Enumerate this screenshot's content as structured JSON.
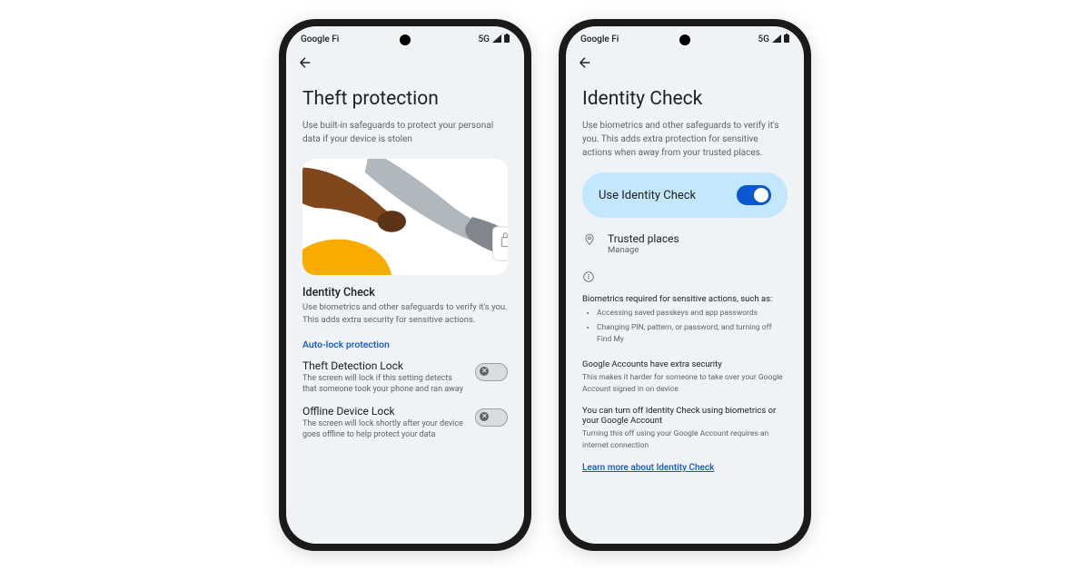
{
  "status": {
    "carrier": "Google Fi",
    "network": "5G"
  },
  "phone1": {
    "title": "Theft protection",
    "subtitle": "Use built-in safeguards to protect your personal data if your device is stolen",
    "section1": {
      "title": "Identity Check",
      "desc": "Use biometrics and other safeguards to verify it's you. This adds extra security for sensitive actions."
    },
    "linkGroup": "Auto-lock protection",
    "theft_detection": {
      "label": "Theft Detection Lock",
      "desc": "The screen will lock if this setting detects that someone took your phone and ran away"
    },
    "offline_lock": {
      "label": "Offline Device Lock",
      "desc": "The screen will lock shortly after your device goes offline to help protect your data"
    }
  },
  "phone2": {
    "title": "Identity Check",
    "subtitle": "Use biometrics and other safeguards to verify it's you. This adds extra protection for sensitive actions when away from your trusted places.",
    "toggle_label": "Use Identity Check",
    "trusted": {
      "title": "Trusted places",
      "sub": "Manage"
    },
    "info1": {
      "heading": "Biometrics required for sensitive actions, such as:",
      "items": [
        "Accessing saved passkeys and app passwords",
        "Changing PIN, pattern, or password, and turning off Find My"
      ]
    },
    "info2": {
      "heading": "Google Accounts have extra security",
      "body": "This makes it harder for someone to take over your Google Account signed in on device"
    },
    "info3": {
      "heading": "You can turn off Identity Check using biometrics or your Google Account",
      "body": "Turning this off using your Google Account requires an internet connection"
    },
    "learn_link": "Learn more about Identity Check"
  }
}
